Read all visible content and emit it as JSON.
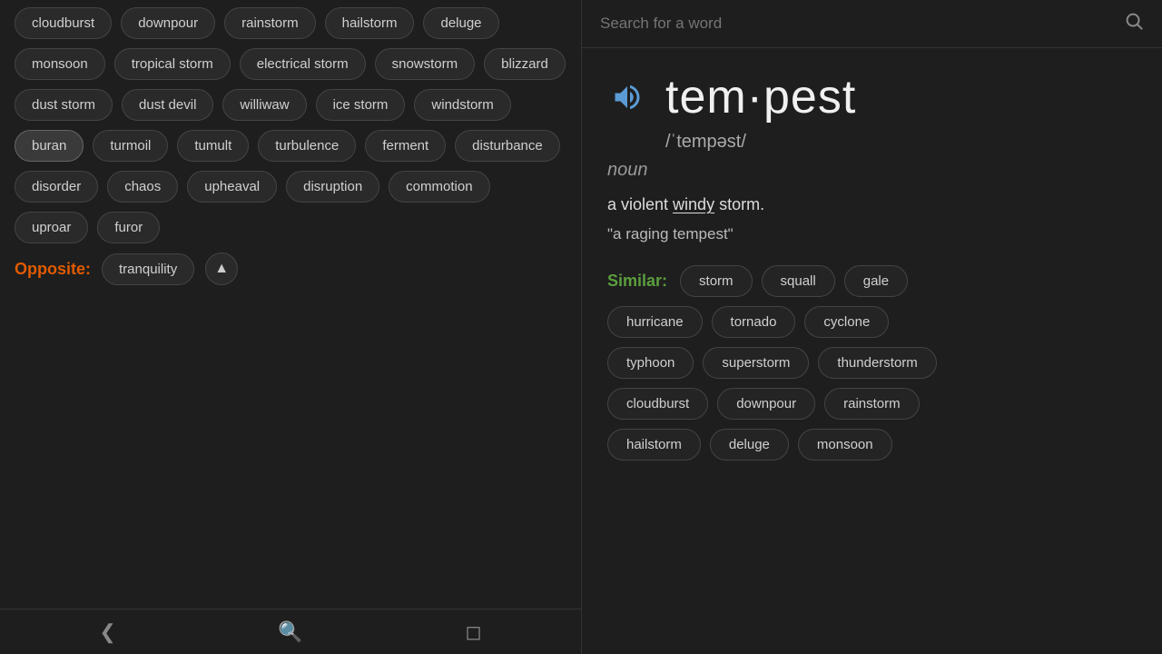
{
  "left": {
    "top_tags": [
      "cloudburst",
      "downpour",
      "rainstorm"
    ],
    "row1": [
      "hailstorm",
      "deluge",
      "monsoon"
    ],
    "row2": [
      "tropical storm",
      "electrical storm"
    ],
    "row3": [
      "snowstorm",
      "blizzard",
      "dust storm"
    ],
    "row4": [
      "dust devil",
      "williwaw",
      "ice storm"
    ],
    "row5": [
      "windstorm",
      "buran",
      "turmoil"
    ],
    "row6": [
      "tumult",
      "turbulence",
      "ferment"
    ],
    "row7": [
      "disturbance",
      "disorder",
      "chaos"
    ],
    "row8": [
      "upheaval",
      "disruption",
      "commotion"
    ],
    "row9": [
      "uproar",
      "furor"
    ],
    "opposite_label": "Opposite:",
    "opposite_tag": "tranquility",
    "collapse_icon": "▲"
  },
  "right": {
    "search_placeholder": "Search for a word",
    "word": "tem·pest",
    "phonetic": "/ˈtempəst/",
    "part_of_speech": "noun",
    "definition_pre": "a violent ",
    "definition_link": "windy",
    "definition_post": " storm.",
    "example": "\"a raging tempest\"",
    "similar_label": "Similar:",
    "similar_row1": [
      "storm",
      "squall",
      "gale"
    ],
    "similar_row2": [
      "hurricane",
      "tornado",
      "cyclone"
    ],
    "similar_row3": [
      "typhoon",
      "superstorm",
      "thunderstorm"
    ],
    "similar_row4": [
      "cloudburst",
      "downpour",
      "rainstorm"
    ],
    "similar_row5": [
      "hailstorm",
      "deluge",
      "monsoon"
    ]
  }
}
